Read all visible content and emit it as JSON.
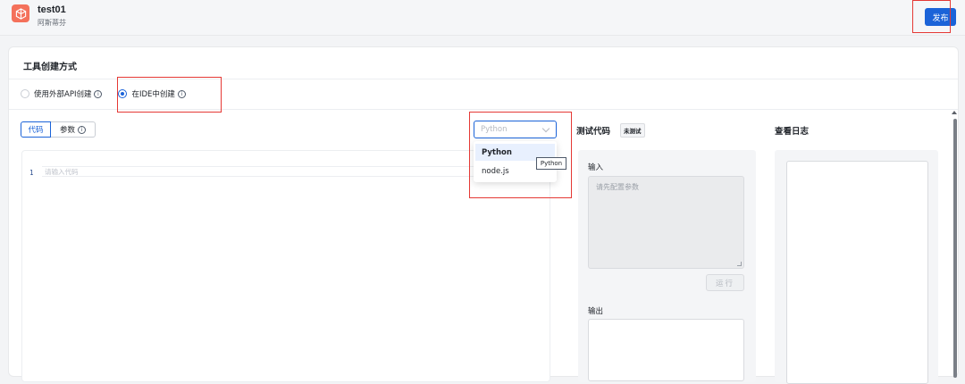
{
  "app": {
    "title": "test01",
    "subtitle": "阿斯蒂芬",
    "publish_label": "发布"
  },
  "section": {
    "title": "工具创建方式"
  },
  "creation_mode": {
    "options": [
      {
        "label": "使用外部API创建",
        "selected": false
      },
      {
        "label": "在IDE中创建",
        "selected": true
      }
    ]
  },
  "editor_tabs": [
    {
      "label": "代码",
      "active": true
    },
    {
      "label": "参数",
      "active": false
    }
  ],
  "language_select": {
    "placeholder": "Python",
    "options": [
      "Python",
      "node.js"
    ],
    "highlighted": "Python",
    "tooltip": "Python"
  },
  "editor": {
    "line_number": "1",
    "placeholder": "请输入代码"
  },
  "test": {
    "title": "测试代码",
    "status_badge": "未测试",
    "input_label": "输入",
    "input_placeholder": "请先配置参数",
    "run_label": "运行",
    "output_label": "输出"
  },
  "log": {
    "title": "查看日志"
  },
  "colors": {
    "accent": "#1b63d8",
    "app_icon": "#f4715b",
    "annotation": "#e53935"
  }
}
